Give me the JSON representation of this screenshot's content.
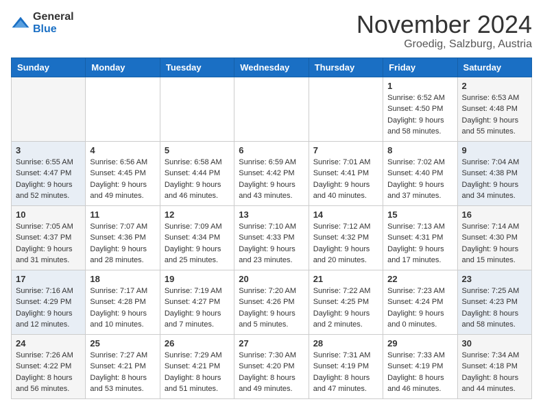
{
  "header": {
    "logo_general": "General",
    "logo_blue": "Blue",
    "month_title": "November 2024",
    "location": "Groedig, Salzburg, Austria"
  },
  "weekdays": [
    "Sunday",
    "Monday",
    "Tuesday",
    "Wednesday",
    "Thursday",
    "Friday",
    "Saturday"
  ],
  "weeks": [
    [
      {
        "day": "",
        "sunrise": "",
        "sunset": "",
        "daylight": "",
        "type": "empty"
      },
      {
        "day": "",
        "sunrise": "",
        "sunset": "",
        "daylight": "",
        "type": "empty"
      },
      {
        "day": "",
        "sunrise": "",
        "sunset": "",
        "daylight": "",
        "type": "empty"
      },
      {
        "day": "",
        "sunrise": "",
        "sunset": "",
        "daylight": "",
        "type": "empty"
      },
      {
        "day": "",
        "sunrise": "",
        "sunset": "",
        "daylight": "",
        "type": "empty"
      },
      {
        "day": "1",
        "sunrise": "6:52 AM",
        "sunset": "4:50 PM",
        "daylight": "9 hours and 58 minutes.",
        "type": "weekday"
      },
      {
        "day": "2",
        "sunrise": "6:53 AM",
        "sunset": "4:48 PM",
        "daylight": "9 hours and 55 minutes.",
        "type": "weekend"
      }
    ],
    [
      {
        "day": "3",
        "sunrise": "6:55 AM",
        "sunset": "4:47 PM",
        "daylight": "9 hours and 52 minutes.",
        "type": "weekend"
      },
      {
        "day": "4",
        "sunrise": "6:56 AM",
        "sunset": "4:45 PM",
        "daylight": "9 hours and 49 minutes.",
        "type": "weekday"
      },
      {
        "day": "5",
        "sunrise": "6:58 AM",
        "sunset": "4:44 PM",
        "daylight": "9 hours and 46 minutes.",
        "type": "weekday"
      },
      {
        "day": "6",
        "sunrise": "6:59 AM",
        "sunset": "4:42 PM",
        "daylight": "9 hours and 43 minutes.",
        "type": "weekday"
      },
      {
        "day": "7",
        "sunrise": "7:01 AM",
        "sunset": "4:41 PM",
        "daylight": "9 hours and 40 minutes.",
        "type": "weekday"
      },
      {
        "day": "8",
        "sunrise": "7:02 AM",
        "sunset": "4:40 PM",
        "daylight": "9 hours and 37 minutes.",
        "type": "weekday"
      },
      {
        "day": "9",
        "sunrise": "7:04 AM",
        "sunset": "4:38 PM",
        "daylight": "9 hours and 34 minutes.",
        "type": "weekend"
      }
    ],
    [
      {
        "day": "10",
        "sunrise": "7:05 AM",
        "sunset": "4:37 PM",
        "daylight": "9 hours and 31 minutes.",
        "type": "weekend"
      },
      {
        "day": "11",
        "sunrise": "7:07 AM",
        "sunset": "4:36 PM",
        "daylight": "9 hours and 28 minutes.",
        "type": "weekday"
      },
      {
        "day": "12",
        "sunrise": "7:09 AM",
        "sunset": "4:34 PM",
        "daylight": "9 hours and 25 minutes.",
        "type": "weekday"
      },
      {
        "day": "13",
        "sunrise": "7:10 AM",
        "sunset": "4:33 PM",
        "daylight": "9 hours and 23 minutes.",
        "type": "weekday"
      },
      {
        "day": "14",
        "sunrise": "7:12 AM",
        "sunset": "4:32 PM",
        "daylight": "9 hours and 20 minutes.",
        "type": "weekday"
      },
      {
        "day": "15",
        "sunrise": "7:13 AM",
        "sunset": "4:31 PM",
        "daylight": "9 hours and 17 minutes.",
        "type": "weekday"
      },
      {
        "day": "16",
        "sunrise": "7:14 AM",
        "sunset": "4:30 PM",
        "daylight": "9 hours and 15 minutes.",
        "type": "weekend"
      }
    ],
    [
      {
        "day": "17",
        "sunrise": "7:16 AM",
        "sunset": "4:29 PM",
        "daylight": "9 hours and 12 minutes.",
        "type": "weekend"
      },
      {
        "day": "18",
        "sunrise": "7:17 AM",
        "sunset": "4:28 PM",
        "daylight": "9 hours and 10 minutes.",
        "type": "weekday"
      },
      {
        "day": "19",
        "sunrise": "7:19 AM",
        "sunset": "4:27 PM",
        "daylight": "9 hours and 7 minutes.",
        "type": "weekday"
      },
      {
        "day": "20",
        "sunrise": "7:20 AM",
        "sunset": "4:26 PM",
        "daylight": "9 hours and 5 minutes.",
        "type": "weekday"
      },
      {
        "day": "21",
        "sunrise": "7:22 AM",
        "sunset": "4:25 PM",
        "daylight": "9 hours and 2 minutes.",
        "type": "weekday"
      },
      {
        "day": "22",
        "sunrise": "7:23 AM",
        "sunset": "4:24 PM",
        "daylight": "9 hours and 0 minutes.",
        "type": "weekday"
      },
      {
        "day": "23",
        "sunrise": "7:25 AM",
        "sunset": "4:23 PM",
        "daylight": "8 hours and 58 minutes.",
        "type": "weekend"
      }
    ],
    [
      {
        "day": "24",
        "sunrise": "7:26 AM",
        "sunset": "4:22 PM",
        "daylight": "8 hours and 56 minutes.",
        "type": "weekend"
      },
      {
        "day": "25",
        "sunrise": "7:27 AM",
        "sunset": "4:21 PM",
        "daylight": "8 hours and 53 minutes.",
        "type": "weekday"
      },
      {
        "day": "26",
        "sunrise": "7:29 AM",
        "sunset": "4:21 PM",
        "daylight": "8 hours and 51 minutes.",
        "type": "weekday"
      },
      {
        "day": "27",
        "sunrise": "7:30 AM",
        "sunset": "4:20 PM",
        "daylight": "8 hours and 49 minutes.",
        "type": "weekday"
      },
      {
        "day": "28",
        "sunrise": "7:31 AM",
        "sunset": "4:19 PM",
        "daylight": "8 hours and 47 minutes.",
        "type": "weekday"
      },
      {
        "day": "29",
        "sunrise": "7:33 AM",
        "sunset": "4:19 PM",
        "daylight": "8 hours and 46 minutes.",
        "type": "weekday"
      },
      {
        "day": "30",
        "sunrise": "7:34 AM",
        "sunset": "4:18 PM",
        "daylight": "8 hours and 44 minutes.",
        "type": "weekend"
      }
    ]
  ],
  "labels": {
    "sunrise": "Sunrise: ",
    "sunset": "Sunset: ",
    "daylight": "Daylight: "
  }
}
